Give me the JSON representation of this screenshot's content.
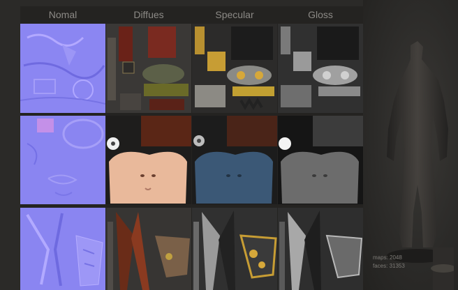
{
  "columns": [
    "Nomal",
    "Diffues",
    "Specular",
    "Gloss"
  ],
  "stats": {
    "maps": "maps: 2048",
    "faces": "faces: 31353"
  },
  "colors": {
    "normal_map": "#8a84f0",
    "diffuse_face": "#e8b89a",
    "specular_face": "#3d5a7a",
    "gloss_face": "#6e6e6e",
    "leather": "#5a2a18",
    "gold": "#b8902a",
    "panel_bg": "#242321"
  }
}
